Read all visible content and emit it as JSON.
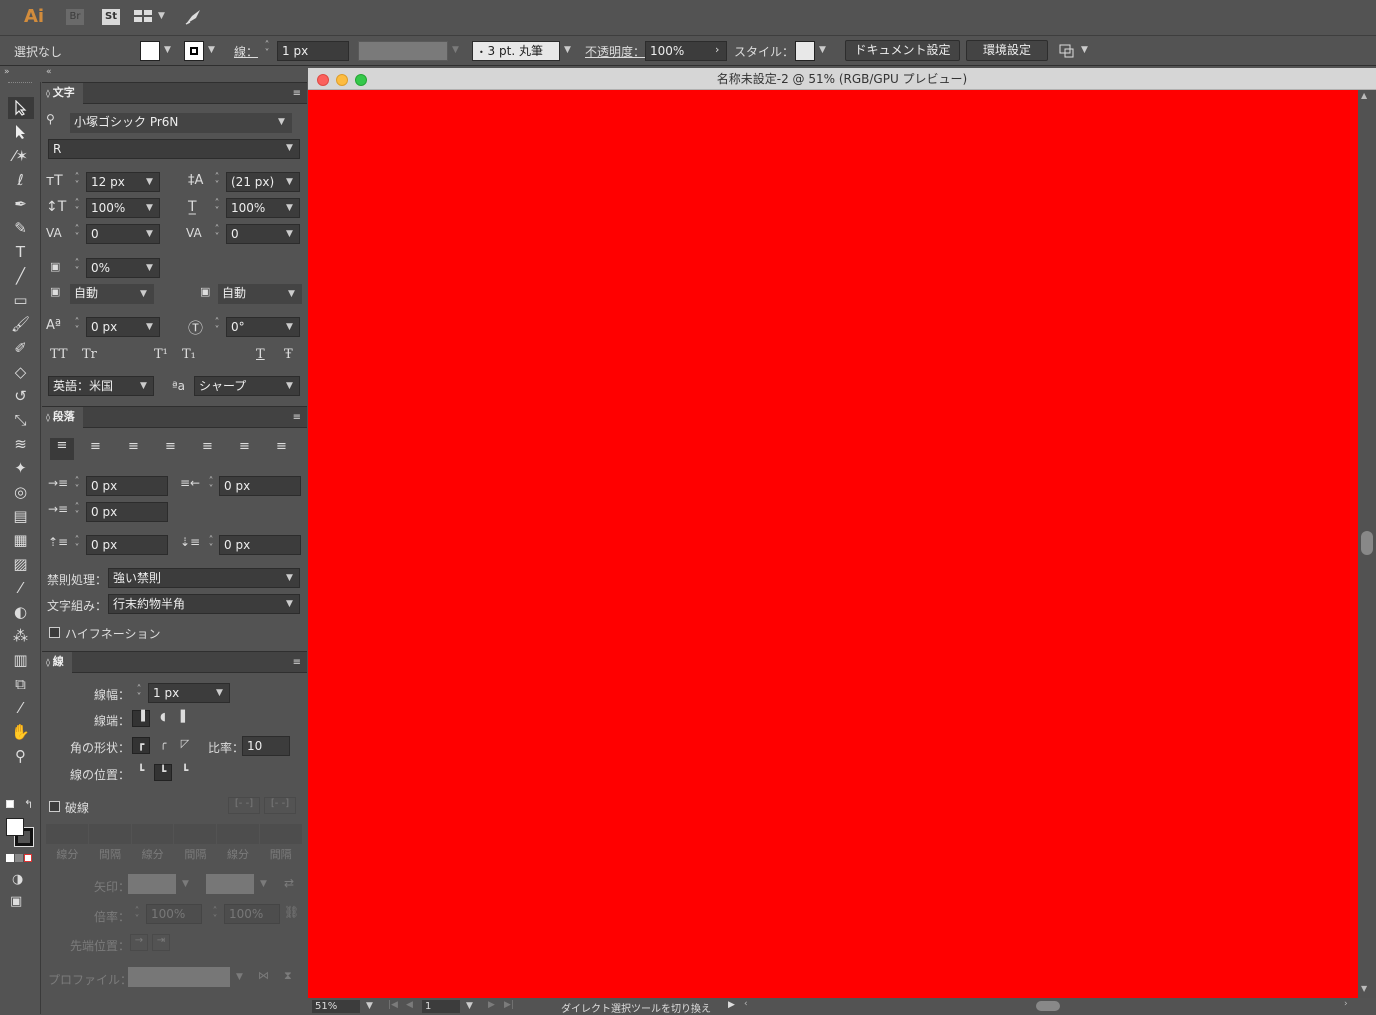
{
  "app": {
    "logo": "Ai",
    "bridge": "Br",
    "stock": "St"
  },
  "control": {
    "selection": "選択なし",
    "stroke_label": "線：",
    "stroke_value": "1 px",
    "brush": "3 pt. 丸筆",
    "opacity_label": "不透明度：",
    "opacity_value": "100%",
    "style_label": "スタイル：",
    "doc_setup": "ドキュメント設定",
    "prefs": "環境設定"
  },
  "document": {
    "title": "名称未設定-2 @ 51% (RGB/GPU プレビュー)",
    "canvas_color": "#ff0000"
  },
  "char_panel": {
    "title": "文字",
    "font_family": "小塚ゴシック Pr6N",
    "font_style": "R",
    "size": "12 px",
    "leading": "(21 px)",
    "vscale": "100%",
    "hscale": "100%",
    "kerning": "0",
    "tracking": "0",
    "tsume": "0%",
    "aki_left": "自動",
    "aki_right": "自動",
    "baseline": "0 px",
    "rotation": "0°",
    "glyphs": [
      "TT",
      "Tr",
      "T¹",
      "T₁",
      "T",
      "Ŧ"
    ],
    "language": "英語：米国",
    "aa_label": "ªa",
    "antialias": "シャープ"
  },
  "para_panel": {
    "title": "段落",
    "indent_left": "0 px",
    "indent_right": "0 px",
    "indent_first": "0 px",
    "space_before": "0 px",
    "space_after": "0 px",
    "kinsoku_label": "禁則処理：",
    "kinsoku": "強い禁則",
    "mojikumi_label": "文字組み：",
    "mojikumi": "行末約物半角",
    "hyphenation": "ハイフネーション"
  },
  "stroke_panel": {
    "title": "線",
    "weight_label": "線幅：",
    "weight": "1 px",
    "cap_label": "線端：",
    "corner_label": "角の形状：",
    "limit_label": "比率：",
    "limit": "10",
    "align_label": "線の位置：",
    "dashed": "破線",
    "dash_labels": [
      "線分",
      "間隔",
      "線分",
      "間隔",
      "線分",
      "間隔"
    ],
    "arrow_label": "矢印：",
    "scale_label": "倍率：",
    "scale_a": "100%",
    "scale_b": "100%",
    "align_arrow_label": "先端位置：",
    "profile_label": "プロファイル："
  },
  "status": {
    "zoom": "51%",
    "page": "1",
    "tool": "ダイレクト選択ツールを切り換え"
  },
  "colors": {
    "canvas": "#ff0000",
    "panel": "#535353",
    "field": "#3c3c3c"
  }
}
